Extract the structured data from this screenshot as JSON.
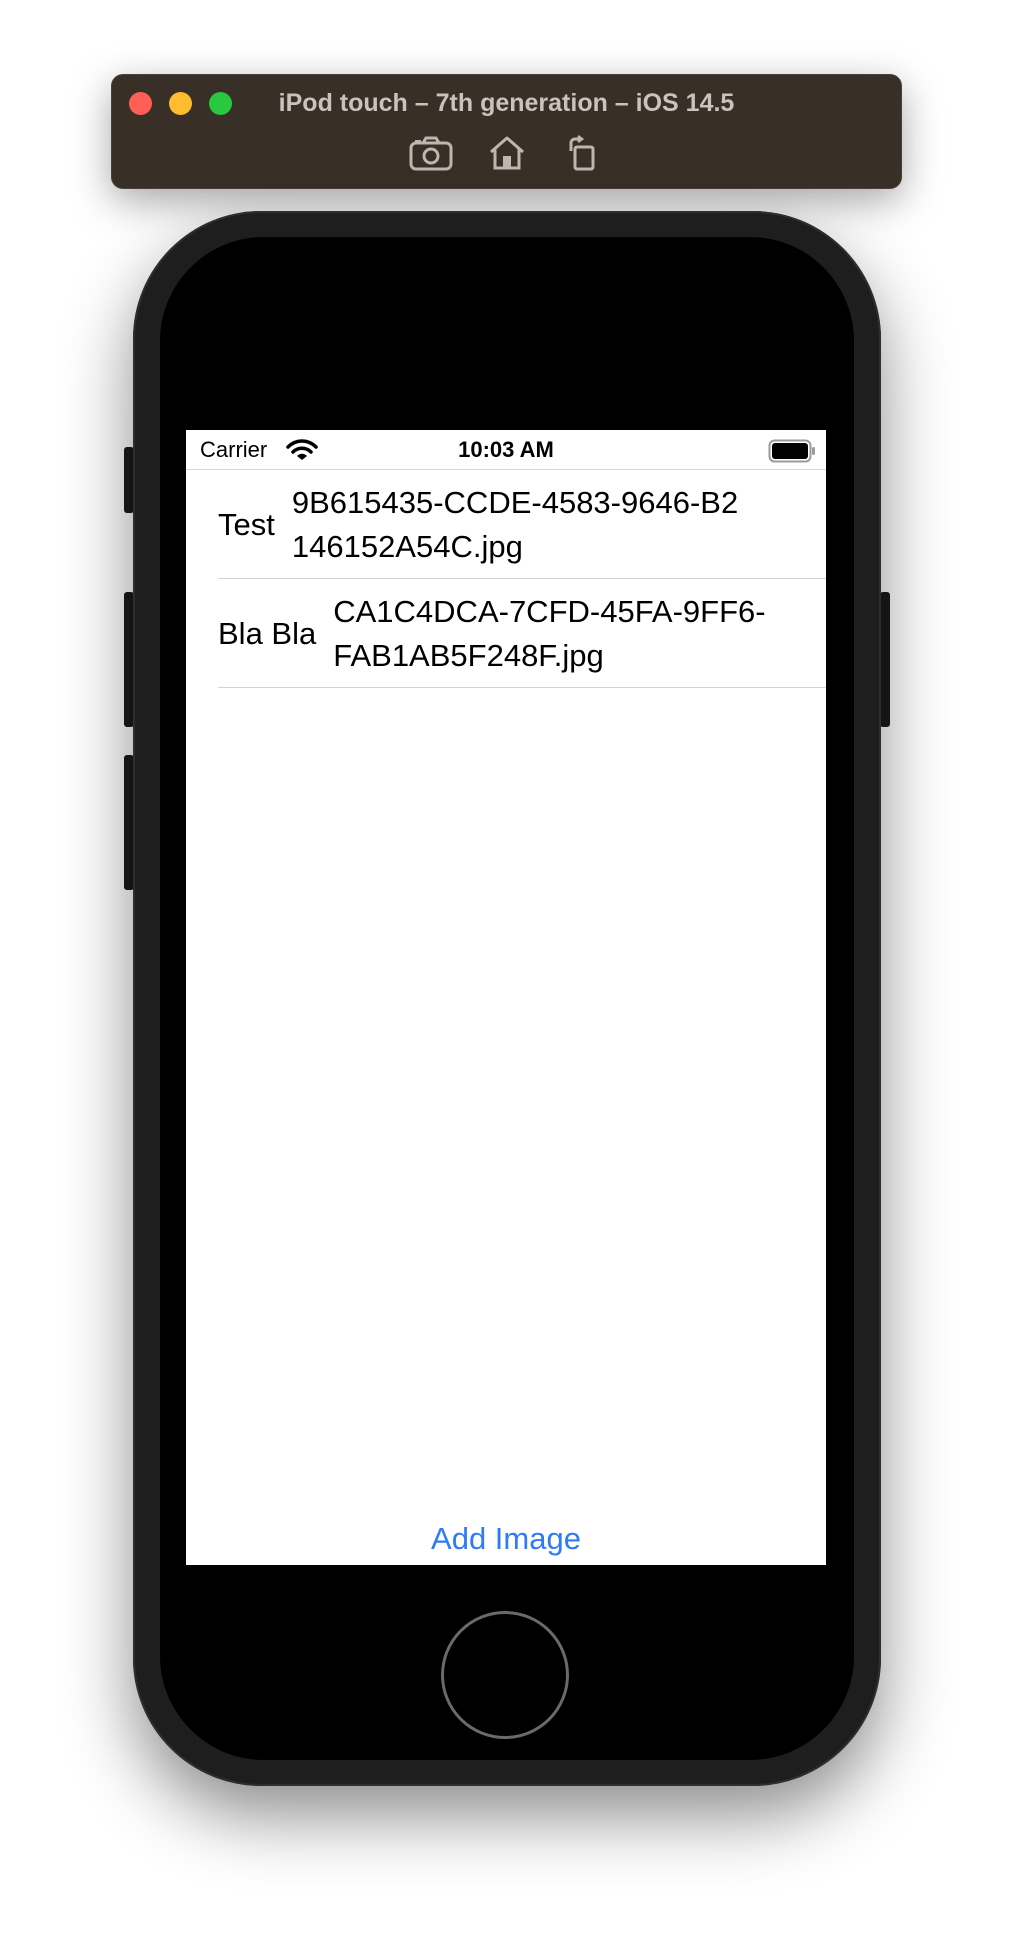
{
  "simulator": {
    "title": "iPod touch – 7th generation – iOS 14.5",
    "tools": [
      {
        "icon": "screenshot-icon"
      },
      {
        "icon": "home-icon"
      },
      {
        "icon": "rotate-icon"
      }
    ]
  },
  "status_bar": {
    "carrier": "Carrier",
    "time": "10:03 AM"
  },
  "rows": [
    {
      "title": "Test",
      "file": "9B615435-CCDE-4583-9646-B2146152A54C.jpg"
    },
    {
      "title": "Bla Bla",
      "file": "CA1C4DCA-7CFD-45FA-9FF6-FAB1AB5F248F.jpg"
    }
  ],
  "add_image_label": "Add Image",
  "colors": {
    "accent": "#2f7bf5",
    "simulator_bar": "#382f26"
  }
}
